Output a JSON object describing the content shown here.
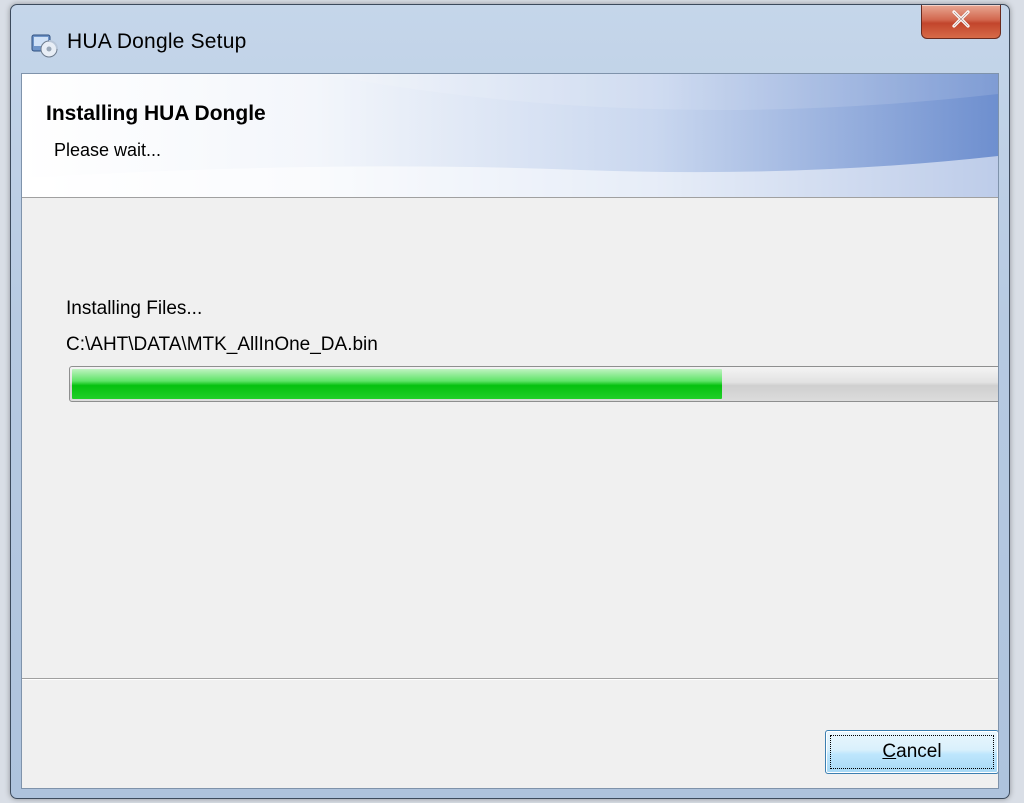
{
  "window": {
    "title": "HUA Dongle Setup",
    "close_icon": "close-icon"
  },
  "header": {
    "title": "Installing HUA Dongle",
    "subtitle": "Please wait..."
  },
  "main": {
    "status": "Installing Files...",
    "current_file": "C:\\AHT\\DATA\\MTK_AllInOne_DA.bin",
    "progress_percent": 70
  },
  "footer": {
    "cancel_label_underlined": "C",
    "cancel_label_rest": "ancel"
  },
  "colors": {
    "progress_fill": "#06c10f",
    "close_button": "#c2452c",
    "header_accent": "#6e8fcf"
  }
}
